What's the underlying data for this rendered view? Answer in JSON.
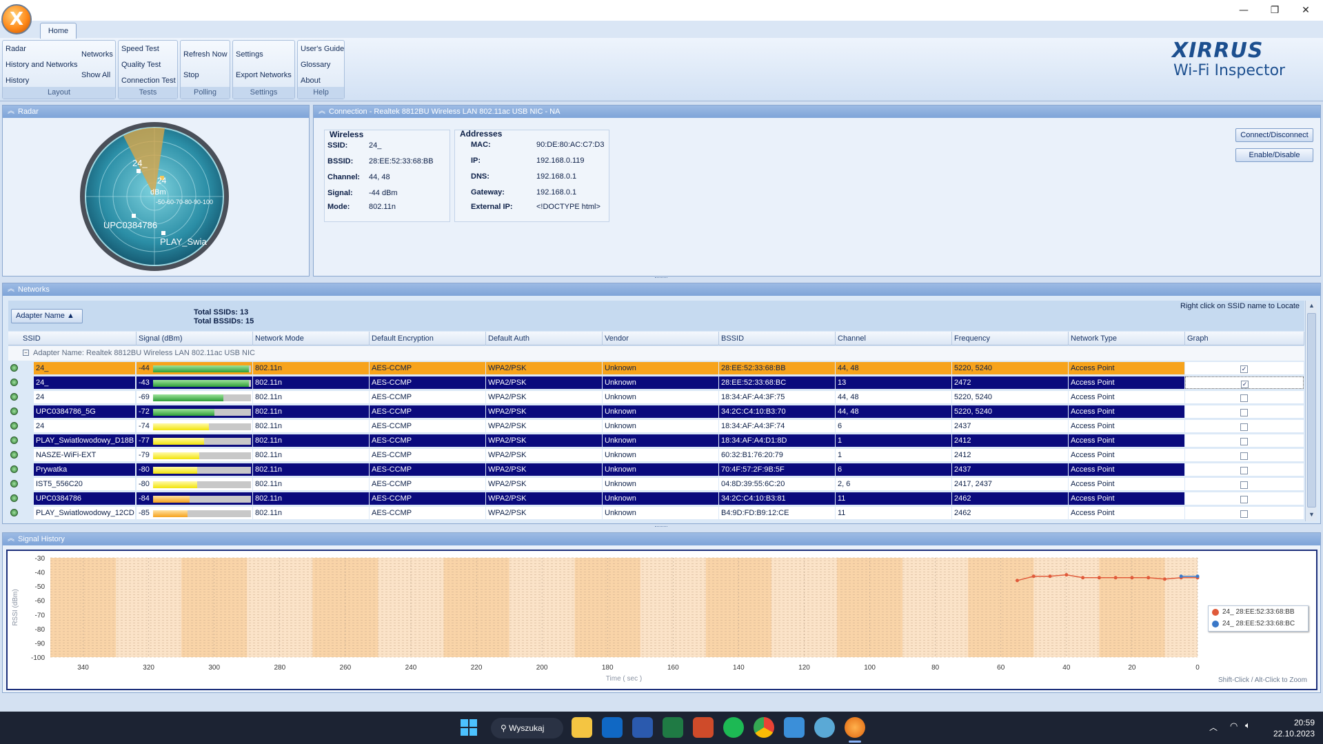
{
  "window": {
    "minimize": "—",
    "restore": "❐",
    "close": "✕"
  },
  "ribbon": {
    "tab": "Home",
    "layout": {
      "items": [
        "Radar",
        "History and Networks",
        "History"
      ],
      "items2": [
        "Networks",
        "Show All"
      ],
      "label": "Layout"
    },
    "tests": {
      "items": [
        "Speed Test",
        "Quality Test",
        "Connection Test"
      ],
      "label": "Tests"
    },
    "polling": {
      "items": [
        "Refresh Now",
        "Stop"
      ],
      "label": "Polling"
    },
    "settings": {
      "items": [
        "Settings",
        "Export Networks"
      ],
      "label": "Settings"
    },
    "help": {
      "items": [
        "User's Guide",
        "Glossary",
        "About"
      ],
      "label": "Help"
    },
    "brand_name": "XIRRUS",
    "brand_product": "Wi-Fi Inspector"
  },
  "radar": {
    "title": "Radar",
    "unit": "dBm",
    "scale": "-50-60-70-80-90-100",
    "labels": [
      "24_",
      "24",
      "UPC0384786",
      "PLAY_Swia"
    ]
  },
  "connection": {
    "title": "Connection - Realtek 8812BU Wireless LAN 802.11ac USB NIC - NA",
    "wireless_title": "Wireless",
    "wireless": [
      {
        "k": "SSID:",
        "v": "24_"
      },
      {
        "k": "BSSID:",
        "v": "28:EE:52:33:68:BB"
      },
      {
        "k": "Channel:",
        "v": "44, 48"
      },
      {
        "k": "Signal:",
        "v": "-44 dBm"
      },
      {
        "k": "Mode:",
        "v": "802.11n"
      }
    ],
    "addresses_title": "Addresses",
    "addresses": [
      {
        "k": "MAC:",
        "v": "90:DE:80:AC:C7:D3"
      },
      {
        "k": "IP:",
        "v": "192.168.0.119"
      },
      {
        "k": "DNS:",
        "v": "192.168.0.1"
      },
      {
        "k": "Gateway:",
        "v": "192.168.0.1"
      },
      {
        "k": "External IP:",
        "v": "<!DOCTYPE html>"
      }
    ],
    "btn_connect": "Connect/Disconnect",
    "btn_enable": "Enable/Disable"
  },
  "networks": {
    "title": "Networks",
    "group_by": "Adapter Name ▲",
    "total_ssids": "Total SSIDs: 13",
    "total_bssids": "Total BSSIDs: 15",
    "hint": "Right click on SSID name to Locate",
    "adapter_row": "Adapter Name: Realtek 8812BU Wireless LAN 802.11ac USB NIC",
    "columns": [
      "SSID",
      "Signal (dBm)",
      "Network Mode",
      "Default Encryption",
      "Default Auth",
      "Vendor",
      "BSSID",
      "Channel",
      "Frequency",
      "Network Type",
      "Graph"
    ],
    "rows": [
      {
        "ssid": "24_",
        "signal": "-44",
        "level": 0.98,
        "mode": "802.11n",
        "enc": "AES-CCMP",
        "auth": "WPA2/PSK",
        "vendor": "Unknown",
        "bssid": "28:EE:52:33:68:BB",
        "channel": "44, 48",
        "freq": "5220, 5240",
        "type": "Access Point",
        "graph": true,
        "style": "orange"
      },
      {
        "ssid": "24_",
        "signal": "-43",
        "level": 0.98,
        "mode": "802.11n",
        "enc": "AES-CCMP",
        "auth": "WPA2/PSK",
        "vendor": "Unknown",
        "bssid": "28:EE:52:33:68:BC",
        "channel": "13",
        "freq": "2472",
        "type": "Access Point",
        "graph": true,
        "style": "navy"
      },
      {
        "ssid": "24",
        "signal": "-69",
        "level": 0.72,
        "mode": "802.11n",
        "enc": "AES-CCMP",
        "auth": "WPA2/PSK",
        "vendor": "Unknown",
        "bssid": "18:34:AF:A4:3F:75",
        "channel": "44, 48",
        "freq": "5220, 5240",
        "type": "Access Point",
        "graph": false,
        "style": "white"
      },
      {
        "ssid": "UPC0384786_5G",
        "signal": "-72",
        "level": 0.63,
        "mode": "802.11n",
        "enc": "AES-CCMP",
        "auth": "WPA2/PSK",
        "vendor": "Unknown",
        "bssid": "34:2C:C4:10:B3:70",
        "channel": "44, 48",
        "freq": "5220, 5240",
        "type": "Access Point",
        "graph": false,
        "style": "navy"
      },
      {
        "ssid": "24",
        "signal": "-74",
        "level": 0.57,
        "mode": "802.11n",
        "enc": "AES-CCMP",
        "auth": "WPA2/PSK",
        "vendor": "Unknown",
        "bssid": "18:34:AF:A4:3F:74",
        "channel": "6",
        "freq": "2437",
        "type": "Access Point",
        "graph": false,
        "style": "white"
      },
      {
        "ssid": "PLAY_Swiatlowodowy_D18B",
        "signal": "-77",
        "level": 0.52,
        "mode": "802.11n",
        "enc": "AES-CCMP",
        "auth": "WPA2/PSK",
        "vendor": "Unknown",
        "bssid": "18:34:AF:A4:D1:8D",
        "channel": "1",
        "freq": "2412",
        "type": "Access Point",
        "graph": false,
        "style": "navy"
      },
      {
        "ssid": "NASZE-WiFi-EXT",
        "signal": "-79",
        "level": 0.47,
        "mode": "802.11n",
        "enc": "AES-CCMP",
        "auth": "WPA2/PSK",
        "vendor": "Unknown",
        "bssid": "60:32:B1:76:20:79",
        "channel": "1",
        "freq": "2412",
        "type": "Access Point",
        "graph": false,
        "style": "white"
      },
      {
        "ssid": "Prywatka",
        "signal": "-80",
        "level": 0.45,
        "mode": "802.11n",
        "enc": "AES-CCMP",
        "auth": "WPA2/PSK",
        "vendor": "Unknown",
        "bssid": "70:4F:57:2F:9B:5F",
        "channel": "6",
        "freq": "2437",
        "type": "Access Point",
        "graph": false,
        "style": "navy"
      },
      {
        "ssid": "IST5_556C20",
        "signal": "-80",
        "level": 0.45,
        "mode": "802.11n",
        "enc": "AES-CCMP",
        "auth": "WPA2/PSK",
        "vendor": "Unknown",
        "bssid": "04:8D:39:55:6C:20",
        "channel": "2, 6",
        "freq": "2417, 2437",
        "type": "Access Point",
        "graph": false,
        "style": "white"
      },
      {
        "ssid": "UPC0384786",
        "signal": "-84",
        "level": 0.37,
        "mode": "802.11n",
        "enc": "AES-CCMP",
        "auth": "WPA2/PSK",
        "vendor": "Unknown",
        "bssid": "34:2C:C4:10:B3:81",
        "channel": "11",
        "freq": "2462",
        "type": "Access Point",
        "graph": false,
        "style": "navy"
      },
      {
        "ssid": "PLAY_Swiatlowodowy_12CD",
        "signal": "-85",
        "level": 0.35,
        "mode": "802.11n",
        "enc": "AES-CCMP",
        "auth": "WPA2/PSK",
        "vendor": "Unknown",
        "bssid": "B4:9D:FD:B9:12:CE",
        "channel": "11",
        "freq": "2462",
        "type": "Access Point",
        "graph": false,
        "style": "white"
      }
    ]
  },
  "signal_history": {
    "title": "Signal History",
    "hint": "Shift-Click / Alt-Click to Zoom"
  },
  "chart_data": {
    "type": "line",
    "xlabel": "Time ( sec )",
    "ylabel": "RSSI (dBm)",
    "xlim": [
      350,
      0
    ],
    "ylim": [
      -100,
      -30
    ],
    "xticks": [
      340,
      320,
      300,
      280,
      260,
      240,
      220,
      200,
      180,
      160,
      140,
      120,
      100,
      80,
      60,
      40,
      20,
      0
    ],
    "yticks": [
      -30,
      -40,
      -50,
      -60,
      -70,
      -80,
      -90,
      -100
    ],
    "series": [
      {
        "name": "24_ 28:EE:52:33:68:BB",
        "color": "#e05a3a",
        "x": [
          55,
          50,
          45,
          40,
          35,
          30,
          25,
          20,
          15,
          10,
          5,
          0
        ],
        "y": [
          -46,
          -43,
          -43,
          -42,
          -44,
          -44,
          -44,
          -44,
          -44,
          -45,
          -44,
          -44
        ]
      },
      {
        "name": "24_ 28:EE:52:33:68:BC",
        "color": "#3a78c8",
        "x": [
          5,
          0
        ],
        "y": [
          -43,
          -43
        ]
      }
    ],
    "grid": true,
    "legend": "right"
  },
  "taskbar": {
    "search": "Wyszukaj",
    "time": "20:59",
    "date": "22.10.2023"
  }
}
